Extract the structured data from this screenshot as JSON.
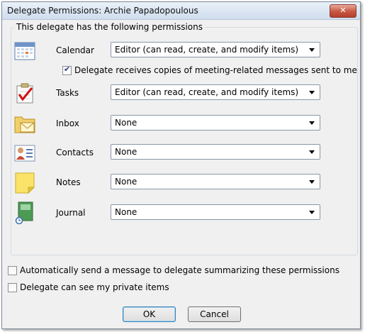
{
  "dialog": {
    "title": "Delegate Permissions: Archie Papadopoulous",
    "close_label": "✕",
    "group_label": "This delegate has the following permissions",
    "permissions": [
      {
        "label": "Calendar",
        "value": "Editor (can read, create, and modify items)",
        "icon": "calendar-icon"
      },
      {
        "label": "Tasks",
        "value": "Editor (can read, create, and modify items)",
        "icon": "tasks-icon"
      },
      {
        "label": "Inbox",
        "value": "None",
        "icon": "inbox-icon"
      },
      {
        "label": "Contacts",
        "value": "None",
        "icon": "contacts-icon"
      },
      {
        "label": "Notes",
        "value": "None",
        "icon": "notes-icon"
      },
      {
        "label": "Journal",
        "value": "None",
        "icon": "journal-icon"
      }
    ],
    "meeting_copies_label": "Delegate receives copies of meeting-related messages sent to me",
    "meeting_copies_checked": true,
    "auto_send_label": "Automatically send a message to delegate summarizing these permissions",
    "auto_send_checked": false,
    "private_items_label": "Delegate can see my private items",
    "private_items_checked": false,
    "ok_label": "OK",
    "cancel_label": "Cancel"
  }
}
